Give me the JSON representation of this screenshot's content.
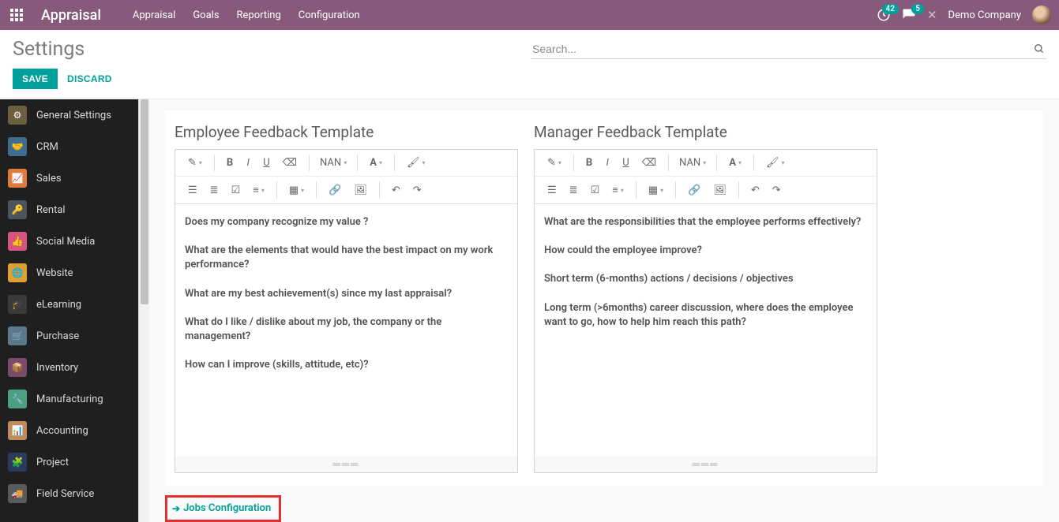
{
  "topnav": {
    "brand": "Appraisal",
    "menu": [
      "Appraisal",
      "Goals",
      "Reporting",
      "Configuration"
    ],
    "clock_badge": "42",
    "chat_badge": "5",
    "company": "Demo Company"
  },
  "control": {
    "title": "Settings",
    "search_placeholder": "Search...",
    "save": "SAVE",
    "discard": "DISCARD"
  },
  "sidebar": {
    "items": [
      {
        "label": "General Settings",
        "color": "#6b5f3f",
        "icon": "gear"
      },
      {
        "label": "CRM",
        "color": "#3f6b8f",
        "icon": "handshake"
      },
      {
        "label": "Sales",
        "color": "#e07b3a",
        "icon": "chart"
      },
      {
        "label": "Rental",
        "color": "#4a5560",
        "icon": "key"
      },
      {
        "label": "Social Media",
        "color": "#d6557d",
        "icon": "thumb"
      },
      {
        "label": "Website",
        "color": "#e0a030",
        "icon": "globe"
      },
      {
        "label": "eLearning",
        "color": "#3a3a3a",
        "icon": "grad"
      },
      {
        "label": "Purchase",
        "color": "#5a7a8a",
        "icon": "cart"
      },
      {
        "label": "Inventory",
        "color": "#7b4a6a",
        "icon": "box"
      },
      {
        "label": "Manufacturing",
        "color": "#4aa080",
        "icon": "wrench"
      },
      {
        "label": "Accounting",
        "color": "#c08a5a",
        "icon": "book"
      },
      {
        "label": "Project",
        "color": "#2a3a5a",
        "icon": "puzzle"
      },
      {
        "label": "Field Service",
        "color": "#5a5a5a",
        "icon": "truck"
      }
    ]
  },
  "main": {
    "employee_template": {
      "title": "Employee Feedback Template",
      "content": [
        "Does my company recognize my value ?",
        "What are the elements that would have the best impact on my work performance?",
        "What are my best achievement(s) since my last appraisal?",
        "What do I like / dislike about my job, the company or the management?",
        "How can I improve (skills, attitude, etc)?"
      ]
    },
    "manager_template": {
      "title": "Manager Feedback Template",
      "content": [
        "What are the responsibilities that the employee performs effectively?",
        "How could the employee improve?",
        "Short term (6-months) actions / decisions / objectives",
        "Long term (>6months) career discussion, where does the employee want to go, how to help him reach this path?"
      ]
    },
    "toolbar_size_label": "NAN",
    "jobs_link": "Jobs Configuration"
  }
}
